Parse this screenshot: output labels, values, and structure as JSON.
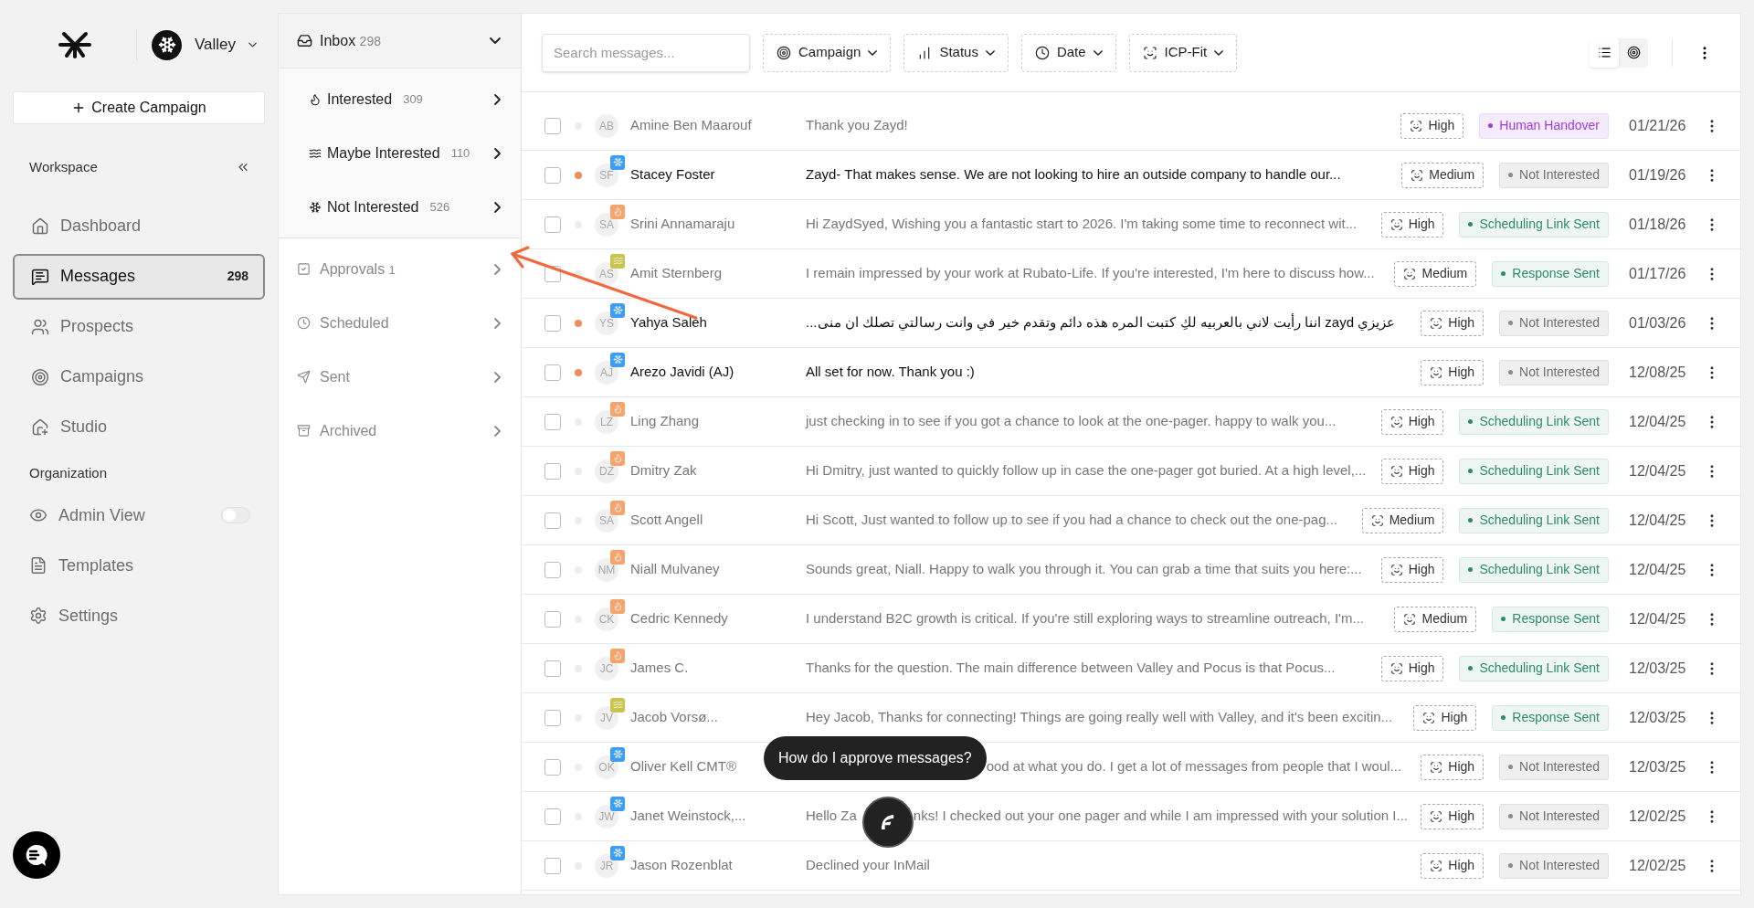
{
  "brand": {
    "workspace": "Valley"
  },
  "create_button": "Create Campaign",
  "workspace_label": "Workspace",
  "nav": [
    {
      "label": "Dashboard",
      "selected": false
    },
    {
      "label": "Messages",
      "count": "298",
      "selected": true
    },
    {
      "label": "Prospects",
      "selected": false
    },
    {
      "label": "Campaigns",
      "selected": false
    },
    {
      "label": "Studio",
      "selected": false
    }
  ],
  "organization_label": "Organization",
  "org_nav": [
    {
      "label": "Admin View",
      "kind": "toggle",
      "on": false
    },
    {
      "label": "Templates",
      "kind": "link"
    },
    {
      "label": "Settings",
      "kind": "link"
    }
  ],
  "inbox": {
    "label": "Inbox",
    "count": "298",
    "expanded": true,
    "children": [
      {
        "label": "Interested",
        "count": "309"
      },
      {
        "label": "Maybe Interested",
        "count": "110"
      },
      {
        "label": "Not Interested",
        "count": "526"
      }
    ]
  },
  "folders": [
    {
      "label": "Approvals",
      "count": "1"
    },
    {
      "label": "Scheduled"
    },
    {
      "label": "Sent"
    },
    {
      "label": "Archived"
    }
  ],
  "search": {
    "placeholder": "Search messages..."
  },
  "filters": [
    {
      "label": "Campaign"
    },
    {
      "label": "Status"
    },
    {
      "label": "Date"
    },
    {
      "label": "ICP-Fit"
    }
  ],
  "views": [
    {
      "selected": true
    },
    {
      "selected": false
    }
  ],
  "rows": [
    {
      "checked": false,
      "initials": "AB",
      "name": "Amine Ben Maarouf",
      "message": "Thank you Zayd!",
      "unread": false,
      "icp": "High",
      "status": {
        "text": "Human Handover",
        "kind": "handover"
      },
      "date": "01/21/26"
    },
    {
      "checked": false,
      "initials": "SF",
      "name": "Stacey Foster",
      "tag": {
        "kind": "cold"
      },
      "message": "Zayd-  That makes sense.  We are not looking to hire an outside company to handle our...",
      "unread": true,
      "icp": "Medium",
      "status": {
        "text": "Not Interested",
        "kind": "negative"
      },
      "date": "01/19/26"
    },
    {
      "checked": false,
      "initials": "SA",
      "name": "Srini Annamaraju",
      "tag": {
        "kind": "hot"
      },
      "message": "Hi ZaydSyed, Wishing you a fantastic start to 2026. I'm taking some time to reconnect wit...",
      "unread": false,
      "icp": "High",
      "status": {
        "text": "Scheduling Link Sent",
        "kind": "positive"
      },
      "date": "01/18/26"
    },
    {
      "checked": false,
      "initials": "AS",
      "name": "Amit Sternberg",
      "tag": {
        "kind": "warm"
      },
      "message": "I remain impressed by your work at Rubato-Life. If you're interested, I'm here to discuss how...",
      "unread": false,
      "icp": "Medium",
      "status": {
        "text": "Response Sent",
        "kind": "positive"
      },
      "date": "01/17/26"
    },
    {
      "checked": false,
      "initials": "YS",
      "name": "Yahya Saleh",
      "tag": {
        "kind": "cold"
      },
      "message": "عزيزي zayd اننا رأيت لاني بالعربيه لكِ كتبت المره هذه دائم وتقدم خير في وانت رسالتي تصلك ان منى...",
      "unread": true,
      "icp": "High",
      "status": {
        "text": "Not Interested",
        "kind": "negative"
      },
      "date": "01/03/26"
    },
    {
      "checked": false,
      "initials": "AJ",
      "name": "Arezo Javidi (AJ)",
      "tag": {
        "kind": "cold"
      },
      "message": "All set for now. Thank you :)",
      "unread": true,
      "icp": "High",
      "status": {
        "text": "Not Interested",
        "kind": "negative"
      },
      "date": "12/08/25"
    },
    {
      "checked": false,
      "initials": "LZ",
      "name": "Ling Zhang",
      "tag": {
        "kind": "hot"
      },
      "message": "just checking in to see if you got a chance to look at the one-pager. happy to walk you...",
      "unread": false,
      "icp": "High",
      "status": {
        "text": "Scheduling Link Sent",
        "kind": "positive"
      },
      "date": "12/04/25"
    },
    {
      "checked": false,
      "initials": "DZ",
      "name": "Dmitry Zak",
      "tag": {
        "kind": "hot"
      },
      "message": "Hi Dmitry, just wanted to quickly follow up in case the one-pager got buried. At a high level,...",
      "unread": false,
      "icp": "High",
      "status": {
        "text": "Scheduling Link Sent",
        "kind": "positive"
      },
      "date": "12/04/25"
    },
    {
      "checked": false,
      "initials": "SA",
      "name": "Scott Angell",
      "tag": {
        "kind": "hot"
      },
      "message": "Hi Scott, Just wanted to follow up to see if you had a chance to check out the one-pag...",
      "unread": false,
      "icp": "Medium",
      "status": {
        "text": "Scheduling Link Sent",
        "kind": "positive"
      },
      "date": "12/04/25"
    },
    {
      "checked": false,
      "initials": "NM",
      "name": "Niall Mulvaney",
      "tag": {
        "kind": "hot"
      },
      "message": "Sounds great, Niall. Happy to walk you through it. You can grab a time that suits you here:...",
      "unread": false,
      "icp": "High",
      "status": {
        "text": "Scheduling Link Sent",
        "kind": "positive"
      },
      "date": "12/04/25"
    },
    {
      "checked": false,
      "initials": "CK",
      "name": "Cedric Kennedy",
      "tag": {
        "kind": "hot"
      },
      "message": "I understand B2C growth is critical. If you're still exploring ways to streamline outreach, I'm...",
      "unread": false,
      "icp": "Medium",
      "status": {
        "text": "Response Sent",
        "kind": "positive"
      },
      "date": "12/04/25"
    },
    {
      "checked": false,
      "initials": "JC",
      "name": "James C.",
      "tag": {
        "kind": "hot"
      },
      "message": "Thanks for the question. The main difference between Valley and Pocus is that Pocus...",
      "unread": false,
      "icp": "High",
      "status": {
        "text": "Scheduling Link Sent",
        "kind": "positive"
      },
      "date": "12/03/25"
    },
    {
      "checked": false,
      "initials": "JV",
      "name": "Jacob Vorsø...",
      "tag": {
        "kind": "warm"
      },
      "message": "Hey Jacob, Thanks for connecting! Things are going really well with Valley, and it's been excitin...",
      "unread": false,
      "icp": "High",
      "status": {
        "text": "Response Sent",
        "kind": "positive"
      },
      "date": "12/03/25"
    },
    {
      "checked": false,
      "initials": "OK",
      "name": "Oliver Kell CMT®",
      "tag": {
        "kind": "cold"
      },
      "overlay": {
        "kind": "tooltip"
      },
      "message_after": "ood at what you do. I get a lot of messages from people that I woul...",
      "unread": false,
      "icp": "High",
      "status": {
        "text": "Not Interested",
        "kind": "negative"
      },
      "date": "12/03/25"
    },
    {
      "checked": false,
      "initials": "JW",
      "name": "Janet Weinstock,...",
      "tag": {
        "kind": "cold"
      },
      "overlay": {
        "kind": "assistant"
      },
      "message": "Hello Za",
      "message_after": "nks! I checked out your one pager and while I am impressed with your solution I...",
      "unread": false,
      "icp": "High",
      "status": {
        "text": "Not Interested",
        "kind": "negative"
      },
      "date": "12/02/25"
    },
    {
      "checked": false,
      "initials": "JR",
      "name": "Jason Rozenblat",
      "tag": {
        "kind": "cold"
      },
      "message": "Declined your InMail",
      "unread": false,
      "icp": "High",
      "status": {
        "text": "Not Interested",
        "kind": "negative"
      },
      "date": "12/02/25"
    }
  ],
  "tooltip": "How do I approve messages?"
}
